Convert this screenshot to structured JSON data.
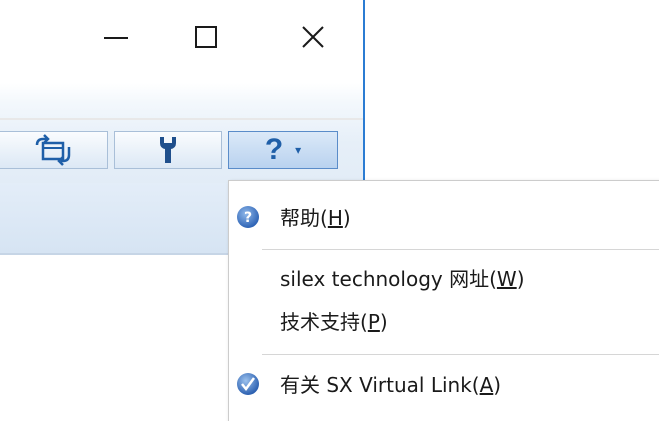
{
  "window": {
    "controls": {
      "minimize_glyph": "—",
      "maximize_glyph": "☐",
      "close_glyph": "✕"
    },
    "accent_color": "#2b7cd3"
  },
  "toolbar": {
    "buttons": [
      {
        "name": "switch-view",
        "icon": "switch-windows-icon"
      },
      {
        "name": "settings",
        "icon": "wrench-icon"
      },
      {
        "name": "help",
        "icon": "question-mark-icon",
        "has_dropdown": true,
        "dropdown_glyph": "▾",
        "label": "?"
      }
    ]
  },
  "help_menu": {
    "items": [
      {
        "key": "help",
        "text": "帮助(",
        "accel": "H",
        "suffix": ")",
        "icon": "help-circle-icon"
      },
      {
        "key": "website",
        "text": "silex technology 网址(",
        "accel": "W",
        "suffix": ")",
        "icon": null
      },
      {
        "key": "support",
        "text": "技术支持(",
        "accel": "P",
        "suffix": ")",
        "icon": null
      },
      {
        "key": "about",
        "text": "有关 SX Virtual Link(",
        "accel": "A",
        "suffix": ")",
        "icon": "info-check-icon"
      }
    ]
  }
}
